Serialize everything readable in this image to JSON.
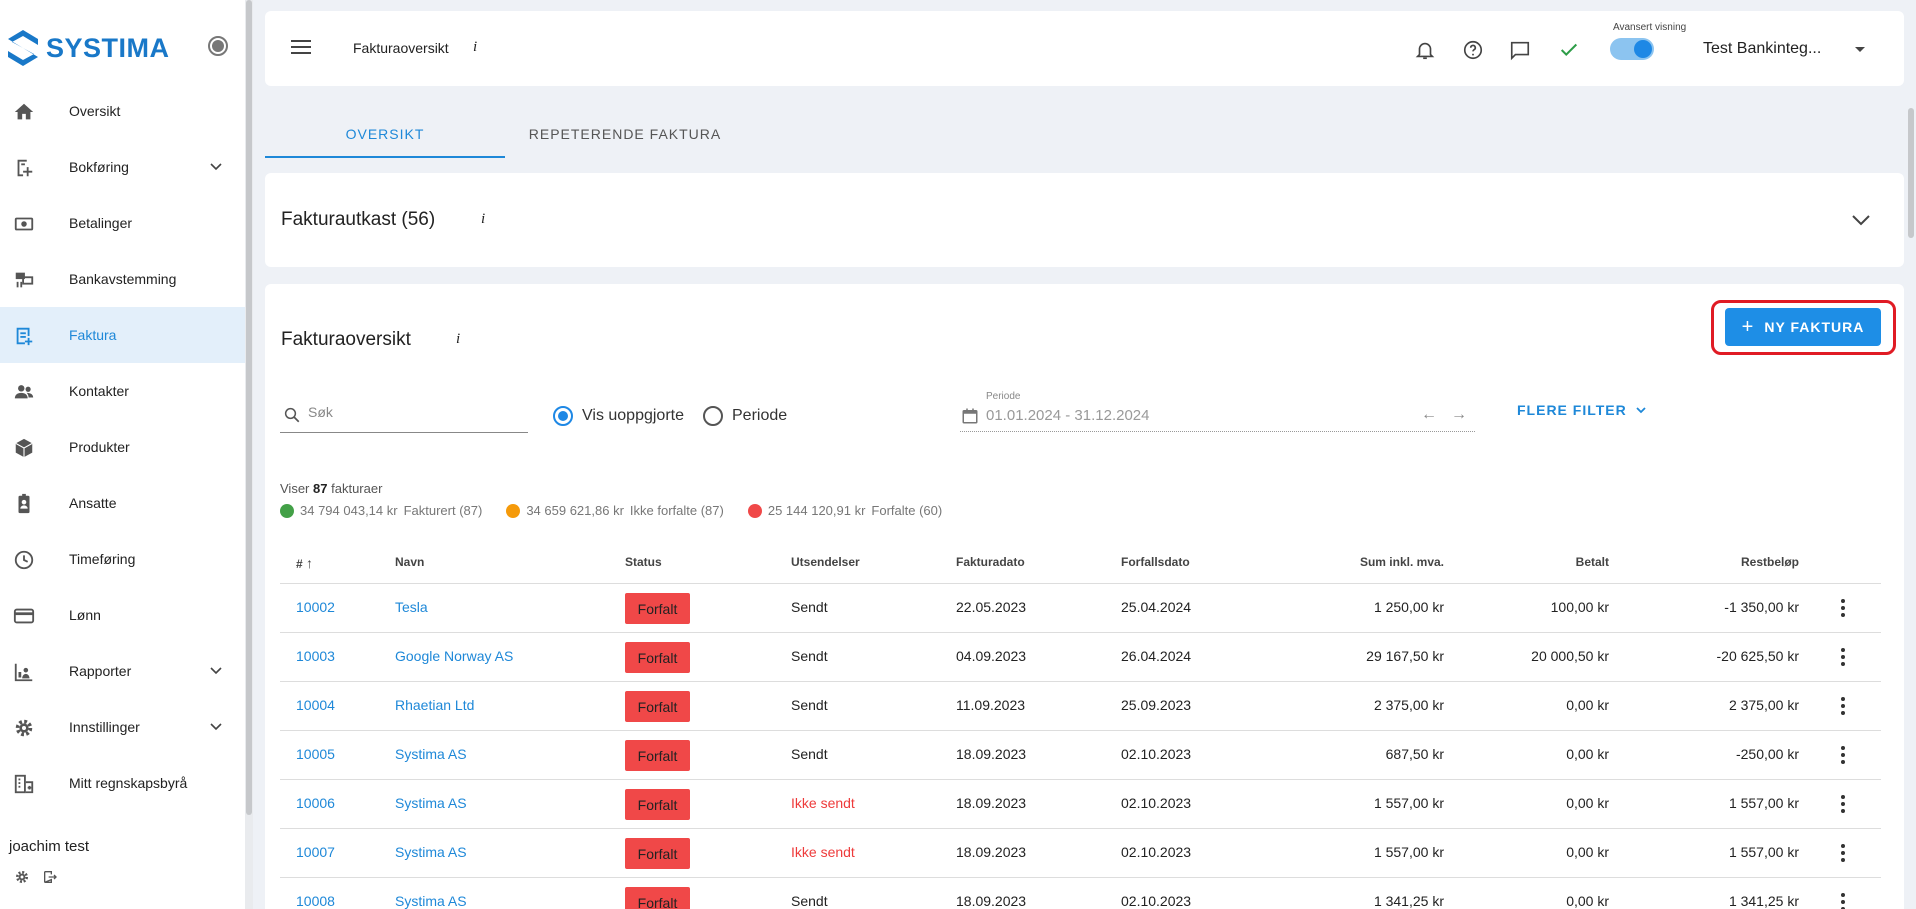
{
  "app": {
    "brand": "SYSTIMA",
    "brand_color": "#1978c8",
    "accent": "#1e88e5"
  },
  "sidebar": {
    "items": [
      {
        "label": "Oversikt",
        "icon": "home-icon"
      },
      {
        "label": "Bokføring",
        "icon": "bookkeeping-icon",
        "expandable": true
      },
      {
        "label": "Betalinger",
        "icon": "payments-icon"
      },
      {
        "label": "Bankavstemming",
        "icon": "bank-reconcile-icon"
      },
      {
        "label": "Faktura",
        "icon": "invoice-icon",
        "active": true
      },
      {
        "label": "Kontakter",
        "icon": "contacts-icon"
      },
      {
        "label": "Produkter",
        "icon": "products-icon"
      },
      {
        "label": "Ansatte",
        "icon": "employees-icon"
      },
      {
        "label": "Timeføring",
        "icon": "clock-icon"
      },
      {
        "label": "Lønn",
        "icon": "salary-icon"
      },
      {
        "label": "Rapporter",
        "icon": "reports-icon",
        "expandable": true
      },
      {
        "label": "Innstillinger",
        "icon": "settings-icon",
        "expandable": true
      },
      {
        "label": "Mitt regnskapsbyrå",
        "icon": "accounting-firm-icon"
      }
    ],
    "user_name": "joachim test"
  },
  "header": {
    "breadcrumb": "Fakturaoversikt",
    "info": "i",
    "toggle_label": "Avansert visning",
    "toggle_on": true,
    "company": "Test Bankinteg..."
  },
  "tabs": [
    {
      "label": "OVERSIKT",
      "active": true
    },
    {
      "label": "REPETERENDE FAKTURA",
      "active": false
    }
  ],
  "drafts": {
    "title": "Fakturautkast (56)",
    "info": "i"
  },
  "overview": {
    "title": "Fakturaoversikt",
    "info": "i",
    "new_button": "NY FAKTURA",
    "search_placeholder": "Søk",
    "radio_unsettled": "Vis uoppgjorte",
    "radio_period": "Periode",
    "period_label": "Periode",
    "period_value": "01.01.2024 - 31.12.2024",
    "more_filters": "FLERE FILTER",
    "showing_prefix": "Viser",
    "showing_count": "87",
    "showing_suffix": "fakturaer",
    "stats": [
      {
        "amount": "34 794 043,14 kr",
        "label": "Fakturert (87)",
        "color": "#43a047"
      },
      {
        "amount": "34 659 621,86 kr",
        "label": "Ikke forfalte (87)",
        "color": "#f59a0a"
      },
      {
        "amount": "25 144 120,91 kr",
        "label": "Forfalte (60)",
        "color": "#f04848"
      }
    ]
  },
  "table": {
    "headers": {
      "num": "#",
      "name": "Navn",
      "status": "Status",
      "sending": "Utsendelser",
      "invoice_date": "Fakturadato",
      "due_date": "Forfallsdato",
      "sum": "Sum inkl. mva.",
      "paid": "Betalt",
      "rest": "Restbeløp"
    },
    "rows": [
      {
        "num": "10002",
        "name": "Tesla",
        "status": "Forfalt",
        "sending": "Sendt",
        "invoice_date": "22.05.2023",
        "due_date": "25.04.2024",
        "sum": "1 250,00 kr",
        "paid": "100,00 kr",
        "rest": "-1 350,00 kr"
      },
      {
        "num": "10003",
        "name": "Google Norway AS",
        "status": "Forfalt",
        "sending": "Sendt",
        "invoice_date": "04.09.2023",
        "due_date": "26.04.2024",
        "sum": "29 167,50 kr",
        "paid": "20 000,50 kr",
        "rest": "-20 625,50 kr"
      },
      {
        "num": "10004",
        "name": "Rhaetian Ltd",
        "status": "Forfalt",
        "sending": "Sendt",
        "invoice_date": "11.09.2023",
        "due_date": "25.09.2023",
        "sum": "2 375,00 kr",
        "paid": "0,00 kr",
        "rest": "2 375,00 kr"
      },
      {
        "num": "10005",
        "name": "Systima AS",
        "status": "Forfalt",
        "sending": "Sendt",
        "invoice_date": "18.09.2023",
        "due_date": "02.10.2023",
        "sum": "687,50 kr",
        "paid": "0,00 kr",
        "rest": "-250,00 kr"
      },
      {
        "num": "10006",
        "name": "Systima AS",
        "status": "Forfalt",
        "sending": "Ikke sendt",
        "invoice_date": "18.09.2023",
        "due_date": "02.10.2023",
        "sum": "1 557,00 kr",
        "paid": "0,00 kr",
        "rest": "1 557,00 kr"
      },
      {
        "num": "10007",
        "name": "Systima AS",
        "status": "Forfalt",
        "sending": "Ikke sendt",
        "invoice_date": "18.09.2023",
        "due_date": "02.10.2023",
        "sum": "1 557,00 kr",
        "paid": "0,00 kr",
        "rest": "1 557,00 kr"
      },
      {
        "num": "10008",
        "name": "Systima AS",
        "status": "Forfalt",
        "sending": "Sendt",
        "invoice_date": "18.09.2023",
        "due_date": "02.10.2023",
        "sum": "1 341,25 kr",
        "paid": "0,00 kr",
        "rest": "1 341,25 kr"
      }
    ]
  }
}
